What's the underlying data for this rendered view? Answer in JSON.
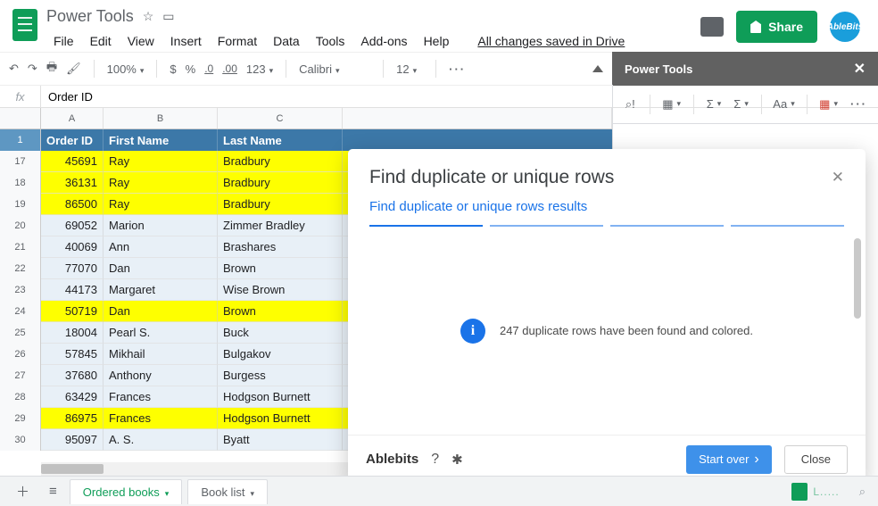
{
  "doc_title": "Power Tools",
  "drive_status": "All changes saved in Drive",
  "share_label": "Share",
  "avatar_label": "AbleBits",
  "menus": {
    "file": "File",
    "edit": "Edit",
    "view": "View",
    "insert": "Insert",
    "format": "Format",
    "data": "Data",
    "tools": "Tools",
    "addons": "Add-ons",
    "help": "Help"
  },
  "toolbar": {
    "zoom": "100%",
    "dollar": "$",
    "percent": "%",
    "dec_dec": ".0",
    "dec_inc": ".00",
    "num": "123",
    "font": "Calibri",
    "size": "12",
    "more": "···"
  },
  "sidebar": {
    "title": "Power Tools",
    "close": "✕"
  },
  "formula_value": "Order ID",
  "columns": {
    "A": "A",
    "B": "B",
    "C": "C"
  },
  "head_row": {
    "num": "1",
    "a": "Order ID",
    "b": "First Name",
    "c": "Last Name"
  },
  "rows": [
    {
      "num": "17",
      "a": "45691",
      "b": "Ray",
      "c": "Bradbury",
      "hl": true
    },
    {
      "num": "18",
      "a": "36131",
      "b": "Ray",
      "c": "Bradbury",
      "hl": true
    },
    {
      "num": "19",
      "a": "86500",
      "b": "Ray",
      "c": "Bradbury",
      "hl": true
    },
    {
      "num": "20",
      "a": "69052",
      "b": "Marion",
      "c": "Zimmer Bradley",
      "hl": false
    },
    {
      "num": "21",
      "a": "40069",
      "b": "Ann",
      "c": "Brashares",
      "hl": false
    },
    {
      "num": "22",
      "a": "77070",
      "b": "Dan",
      "c": "Brown",
      "hl": false
    },
    {
      "num": "23",
      "a": "44173",
      "b": "Margaret",
      "c": "Wise Brown",
      "hl": false
    },
    {
      "num": "24",
      "a": "50719",
      "b": "Dan",
      "c": "Brown",
      "hl": true
    },
    {
      "num": "25",
      "a": "18004",
      "b": "Pearl S.",
      "c": "Buck",
      "hl": false
    },
    {
      "num": "26",
      "a": "57845",
      "b": "Mikhail",
      "c": "Bulgakov",
      "hl": false
    },
    {
      "num": "27",
      "a": "37680",
      "b": "Anthony",
      "c": "Burgess",
      "hl": false
    },
    {
      "num": "28",
      "a": "63429",
      "b": "Frances",
      "c": "Hodgson Burnett",
      "hl": false
    },
    {
      "num": "29",
      "a": "86975",
      "b": "Frances",
      "c": "Hodgson Burnett",
      "hl": true
    },
    {
      "num": "30",
      "a": "95097",
      "b": "A. S.",
      "c": "Byatt",
      "hl": false
    }
  ],
  "modal": {
    "title": "Find duplicate or unique rows",
    "subtitle": "Find duplicate or unique rows results",
    "message": "247 duplicate rows have been found and colored.",
    "brand": "Ablebits",
    "start_over": "Start over",
    "close": "Close"
  },
  "tabs": {
    "active": "Ordered books",
    "other": "Book list"
  },
  "explore_cut": "L....."
}
